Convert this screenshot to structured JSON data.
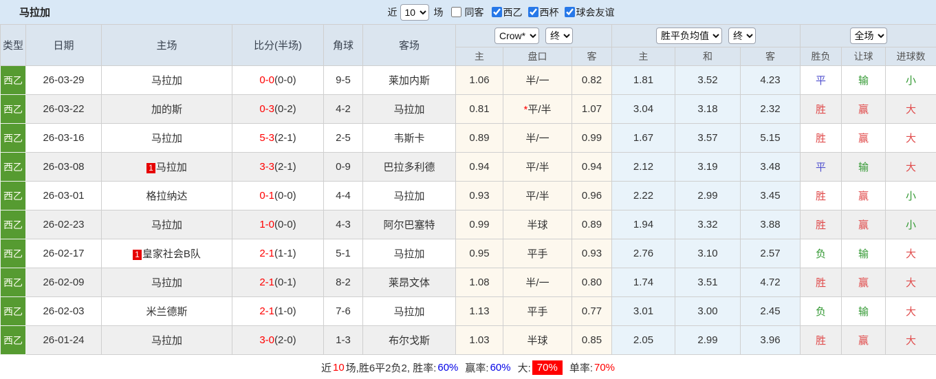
{
  "page": {
    "title": "马拉加",
    "filter": {
      "recent_label": "近",
      "recent_value": "10",
      "matches_label": "场",
      "checkboxes": [
        {
          "label": "同客",
          "checked": false
        },
        {
          "label": "西乙",
          "checked": true
        },
        {
          "label": "西杯",
          "checked": true
        },
        {
          "label": "球会友谊",
          "checked": true
        }
      ]
    }
  },
  "table": {
    "headers": {
      "type": "类型",
      "date": "日期",
      "home": "主场",
      "score": "比分(半场)",
      "corner": "角球",
      "away": "客场",
      "odds_group": {
        "bookmaker": "Crow*",
        "time": "终"
      },
      "avg_group": {
        "label": "胜平负均值",
        "time": "终"
      },
      "result_group": {
        "label": "全场"
      },
      "sub": {
        "odds_home": "主",
        "handicap": "盘口",
        "odds_away": "客",
        "avg_win": "主",
        "avg_draw": "和",
        "avg_loss": "客",
        "result": "胜负",
        "handicap_result": "让球",
        "goals": "进球数"
      }
    },
    "colors": {
      "win": "#e04b4b",
      "draw": "#5050cf",
      "lose": "#339933",
      "self_team": "#339933",
      "score": "#ff0000",
      "type_bg": "#569b31"
    },
    "rows": [
      {
        "type": "西乙",
        "date": "26-03-29",
        "home": "马拉加",
        "home_self": true,
        "home_badge": "",
        "score": "0-0",
        "half": "(0-0)",
        "corner": "9-5",
        "away": "莱加内斯",
        "away_self": false,
        "odds_home": "1.06",
        "handicap": "半/一",
        "handicap_star": false,
        "odds_away": "0.82",
        "avg_win": "1.81",
        "avg_draw": "3.52",
        "avg_loss": "4.23",
        "result": "平",
        "handicap_result": "输",
        "goals": "小"
      },
      {
        "type": "西乙",
        "date": "26-03-22",
        "home": "加的斯",
        "home_self": false,
        "home_badge": "",
        "score": "0-3",
        "half": "(0-2)",
        "corner": "4-2",
        "away": "马拉加",
        "away_self": true,
        "odds_home": "0.81",
        "handicap": "平/半",
        "handicap_star": true,
        "odds_away": "1.07",
        "avg_win": "3.04",
        "avg_draw": "3.18",
        "avg_loss": "2.32",
        "result": "胜",
        "handicap_result": "赢",
        "goals": "大"
      },
      {
        "type": "西乙",
        "date": "26-03-16",
        "home": "马拉加",
        "home_self": true,
        "home_badge": "",
        "score": "5-3",
        "half": "(2-1)",
        "corner": "2-5",
        "away": "韦斯卡",
        "away_self": false,
        "odds_home": "0.89",
        "handicap": "半/一",
        "handicap_star": false,
        "odds_away": "0.99",
        "avg_win": "1.67",
        "avg_draw": "3.57",
        "avg_loss": "5.15",
        "result": "胜",
        "handicap_result": "赢",
        "goals": "大"
      },
      {
        "type": "西乙",
        "date": "26-03-08",
        "home": "马拉加",
        "home_self": true,
        "home_badge": "1",
        "score": "3-3",
        "half": "(2-1)",
        "corner": "0-9",
        "away": "巴拉多利德",
        "away_self": false,
        "odds_home": "0.94",
        "handicap": "平/半",
        "handicap_star": false,
        "odds_away": "0.94",
        "avg_win": "2.12",
        "avg_draw": "3.19",
        "avg_loss": "3.48",
        "result": "平",
        "handicap_result": "输",
        "goals": "大"
      },
      {
        "type": "西乙",
        "date": "26-03-01",
        "home": "格拉纳达",
        "home_self": false,
        "home_badge": "",
        "score": "0-1",
        "half": "(0-0)",
        "corner": "4-4",
        "away": "马拉加",
        "away_self": true,
        "odds_home": "0.93",
        "handicap": "平/半",
        "handicap_star": false,
        "odds_away": "0.96",
        "avg_win": "2.22",
        "avg_draw": "2.99",
        "avg_loss": "3.45",
        "result": "胜",
        "handicap_result": "赢",
        "goals": "小"
      },
      {
        "type": "西乙",
        "date": "26-02-23",
        "home": "马拉加",
        "home_self": true,
        "home_badge": "",
        "score": "1-0",
        "half": "(0-0)",
        "corner": "4-3",
        "away": "阿尔巴塞特",
        "away_self": false,
        "odds_home": "0.99",
        "handicap": "半球",
        "handicap_star": false,
        "odds_away": "0.89",
        "avg_win": "1.94",
        "avg_draw": "3.32",
        "avg_loss": "3.88",
        "result": "胜",
        "handicap_result": "赢",
        "goals": "小"
      },
      {
        "type": "西乙",
        "date": "26-02-17",
        "home": "皇家社会B队",
        "home_self": false,
        "home_badge": "1",
        "score": "2-1",
        "half": "(1-1)",
        "corner": "5-1",
        "away": "马拉加",
        "away_self": true,
        "odds_home": "0.95",
        "handicap": "平手",
        "handicap_star": false,
        "odds_away": "0.93",
        "avg_win": "2.76",
        "avg_draw": "3.10",
        "avg_loss": "2.57",
        "result": "负",
        "handicap_result": "输",
        "goals": "大"
      },
      {
        "type": "西乙",
        "date": "26-02-09",
        "home": "马拉加",
        "home_self": true,
        "home_badge": "",
        "score": "2-1",
        "half": "(0-1)",
        "corner": "8-2",
        "away": "莱昂文体",
        "away_self": false,
        "odds_home": "1.08",
        "handicap": "半/一",
        "handicap_star": false,
        "odds_away": "0.80",
        "avg_win": "1.74",
        "avg_draw": "3.51",
        "avg_loss": "4.72",
        "result": "胜",
        "handicap_result": "赢",
        "goals": "大"
      },
      {
        "type": "西乙",
        "date": "26-02-03",
        "home": "米兰德斯",
        "home_self": false,
        "home_badge": "",
        "score": "2-1",
        "half": "(1-0)",
        "corner": "7-6",
        "away": "马拉加",
        "away_self": true,
        "odds_home": "1.13",
        "handicap": "平手",
        "handicap_star": false,
        "odds_away": "0.77",
        "avg_win": "3.01",
        "avg_draw": "3.00",
        "avg_loss": "2.45",
        "result": "负",
        "handicap_result": "输",
        "goals": "大"
      },
      {
        "type": "西乙",
        "date": "26-01-24",
        "home": "马拉加",
        "home_self": true,
        "home_badge": "",
        "score": "3-0",
        "half": "(2-0)",
        "corner": "1-3",
        "away": "布尔戈斯",
        "away_self": false,
        "odds_home": "1.03",
        "handicap": "半球",
        "handicap_star": false,
        "odds_away": "0.85",
        "avg_win": "2.05",
        "avg_draw": "2.99",
        "avg_loss": "3.96",
        "result": "胜",
        "handicap_result": "赢",
        "goals": "大"
      }
    ]
  },
  "footer": {
    "prefix": "近",
    "count": "10",
    "summary": "场,胜6平2负2, 胜率:",
    "win_rate": "60%",
    "odds_label": "赢率:",
    "odds_rate": "60%",
    "big_label": "大:",
    "big_rate": "70%",
    "single_label": "单率:",
    "single_rate": "70%"
  }
}
